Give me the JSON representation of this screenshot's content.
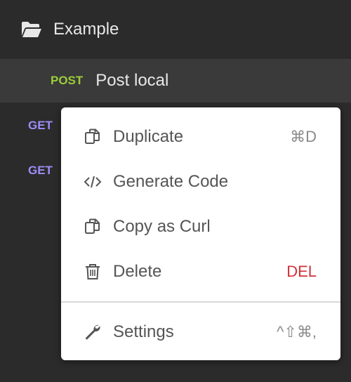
{
  "sidebar": {
    "folder": {
      "label": "Example",
      "icon": "folder-open-icon"
    },
    "requests": [
      {
        "method": "POST",
        "name": "Post local"
      },
      {
        "method": "GET",
        "name": ""
      },
      {
        "method": "GET",
        "name": ""
      }
    ]
  },
  "context_menu": {
    "items": [
      {
        "label": "Duplicate",
        "shortcut": "⌘D",
        "icon": "duplicate-icon"
      },
      {
        "label": "Generate Code",
        "shortcut": "",
        "icon": "code-icon"
      },
      {
        "label": "Copy as Curl",
        "shortcut": "",
        "icon": "copy-icon"
      },
      {
        "label": "Delete",
        "shortcut": "DEL",
        "icon": "trash-icon"
      }
    ],
    "settings": {
      "label": "Settings",
      "shortcut": "^⇧⌘,",
      "icon": "wrench-icon"
    }
  },
  "colors": {
    "background": "#2b2b2b",
    "active_row": "#3a3a3a",
    "post": "#9bcd3a",
    "get": "#9d8cf7",
    "danger": "#d0313a"
  }
}
